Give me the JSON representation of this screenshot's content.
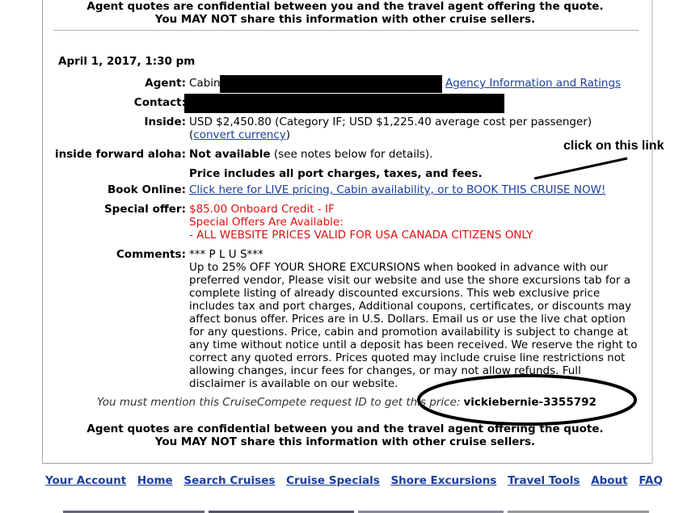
{
  "notice": {
    "line1": "Agent quotes are confidential between you and the travel agent offering the quote.",
    "line2": "You MAY NOT share this information with other cruise sellers."
  },
  "quote": {
    "date": "April 1, 2017, 1:30 pm",
    "agent_label": "Agent:",
    "agent_value": "Cabin",
    "agency_link": "Agency Information and Ratings",
    "contact_label": "Contact:",
    "inside_label": "Inside:",
    "inside_price": "USD $2,450.80 (Category IF; USD $1,225.40 average cost per passenger)",
    "convert_open": "(",
    "convert_link": "convert currency",
    "convert_close": ")",
    "aloha_label": "inside forward aloha:",
    "aloha_value": "Not available",
    "aloha_note": "(see notes below for details).",
    "price_includes": "Price includes all port charges, taxes, and fees.",
    "book_label": "Book Online:",
    "book_link": "Click here for LIVE pricing, Cabin availability, or to BOOK THIS CRUISE NOW!",
    "special_label": "Special offer:",
    "special_lines": [
      "$85.00 Onboard Credit - IF",
      "Special Offers Are Available:",
      "- ALL WEBSITE PRICES VALID FOR USA CANADA CITIZENS ONLY"
    ],
    "comments_label": "Comments:",
    "comments_title": "*** P L U S***",
    "comments_body": "Up to 25% OFF YOUR SHORE EXCURSIONS when booked in advance with our preferred vendor, Please visit our website and use the shore excursions tab for a complete listing of already discounted excursions. This web exclusive price includes tax and port charges, Additional coupons, certificates, or discounts may affect bonus offer. Prices are in U.S. Dollars. Email us or use the live chat option for any questions. Price, cabin and promotion availability is subject to change at any time without notice until a deposit has been received. We reserve the right to correct any quoted errors. Prices quoted may include cruise line restrictions not allowing changes, incur fees for changes, or may not allow refunds. Full disclaimer is available on our website.",
    "mention_text": "You must mention this CruiseCompete request ID to get this price:",
    "request_id": "vickiebernie-3355792"
  },
  "annotation": {
    "text": "click on this link"
  },
  "footer": {
    "links": [
      "Your Account",
      "Home",
      "Search Cruises",
      "Cruise Specials",
      "Shore Excursions",
      "Travel Tools",
      "About",
      "FAQ"
    ]
  }
}
